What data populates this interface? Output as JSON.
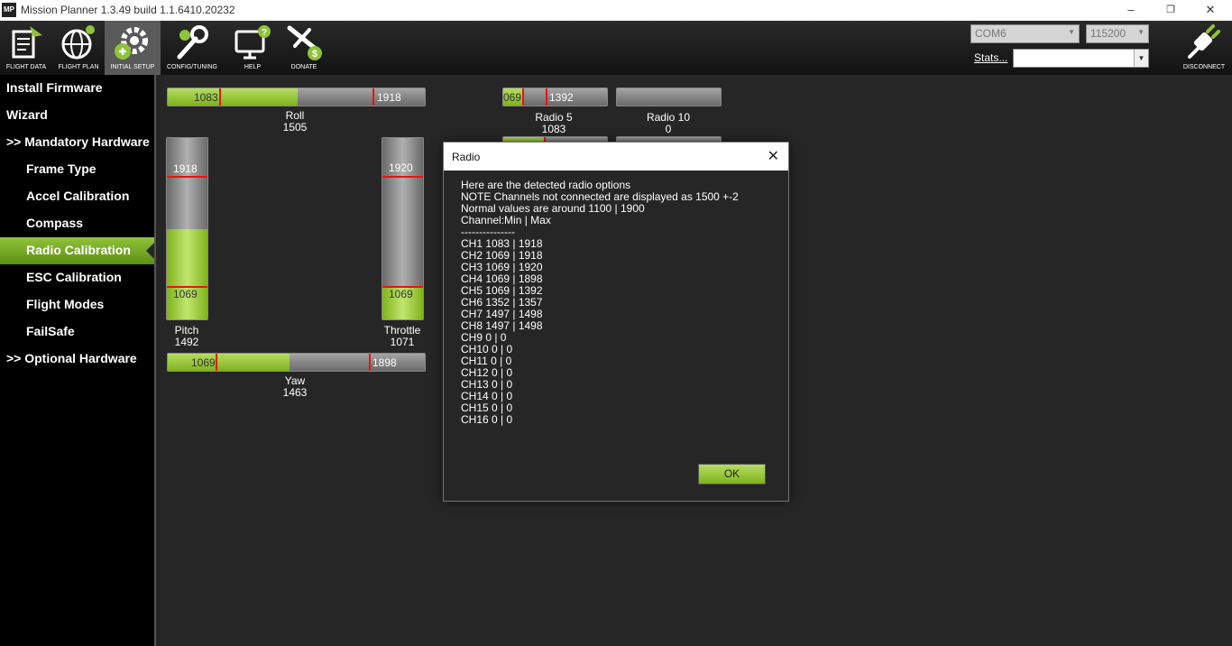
{
  "window": {
    "app_icon": "MP",
    "title": "Mission Planner 1.3.49 build 1.1.6410.20232"
  },
  "toolbar": {
    "buttons": [
      {
        "label": "FLIGHT DATA"
      },
      {
        "label": "FLIGHT PLAN"
      },
      {
        "label": "INITIAL SETUP"
      },
      {
        "label": "CONFIG/TUNING"
      },
      {
        "label": "HELP"
      },
      {
        "label": "DONATE"
      }
    ],
    "com_port": "COM6",
    "baud_rate": "115200",
    "stats_label": "Stats...",
    "disconnect_label": "DISCONNECT"
  },
  "sidebar": {
    "items": [
      {
        "label": "Install Firmware"
      },
      {
        "label": "Wizard"
      },
      {
        "label": ">> Mandatory Hardware"
      },
      {
        "label": "Frame Type"
      },
      {
        "label": "Accel Calibration"
      },
      {
        "label": "Compass"
      },
      {
        "label": "Radio Calibration"
      },
      {
        "label": "ESC Calibration"
      },
      {
        "label": "Flight Modes"
      },
      {
        "label": "FailSafe"
      },
      {
        "label": ">> Optional Hardware"
      }
    ]
  },
  "channels": {
    "roll": {
      "name": "Roll",
      "value": "1505",
      "min": "1083",
      "max": "1918"
    },
    "pitch": {
      "name": "Pitch",
      "value": "1492",
      "min": "1069",
      "max": "1918"
    },
    "throttle": {
      "name": "Throttle",
      "value": "1071",
      "min": "1069",
      "max": "1920"
    },
    "yaw": {
      "name": "Yaw",
      "value": "1463",
      "min": "1069",
      "max": "1898"
    },
    "radio5": {
      "name": "Radio 5",
      "value": "1083",
      "min": "069",
      "max": "1392"
    },
    "radio10": {
      "name": "Radio 10",
      "value": "0"
    }
  },
  "dialog": {
    "title": "Radio",
    "body": "Here are the detected radio options\nNOTE Channels not connected are displayed as 1500 +-2\nNormal values are around 1100 | 1900\nChannel:Min | Max\n---------------\nCH1 1083 | 1918\nCH2 1069 | 1918\nCH3 1069 | 1920\nCH4 1069 | 1898\nCH5 1069 | 1392\nCH6 1352 | 1357\nCH7 1497 | 1498\nCH8 1497 | 1498\nCH9 0 | 0\nCH10 0 | 0\nCH11 0 | 0\nCH12 0 | 0\nCH13 0 | 0\nCH14 0 | 0\nCH15 0 | 0\nCH16 0 | 0",
    "ok_label": "OK"
  },
  "colors": {
    "accent": "#8fc33a",
    "marker": "#e11111"
  }
}
